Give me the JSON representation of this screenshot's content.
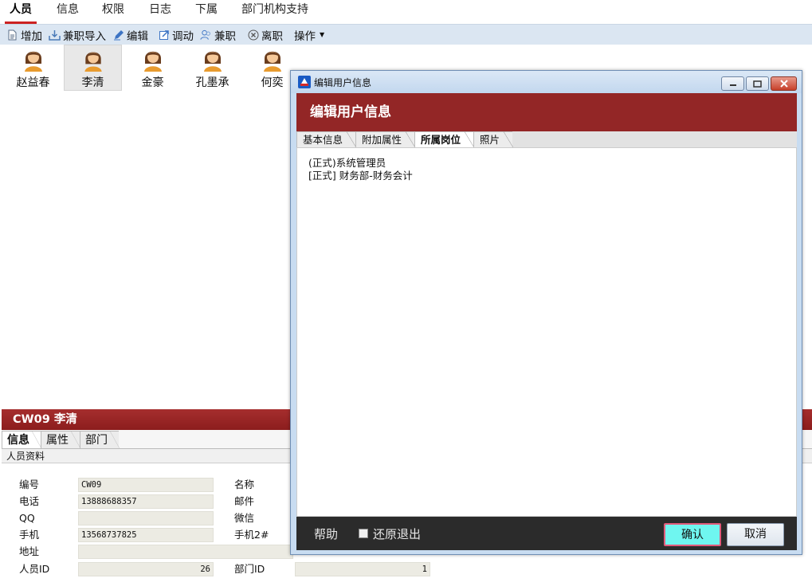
{
  "top_menu": [
    "人员",
    "信息",
    "权限",
    "日志",
    "下属",
    "部门机构支持"
  ],
  "toolbar": {
    "add": "增加",
    "import": "兼职导入",
    "edit": "编辑",
    "transfer": "调动",
    "parttime": "兼职",
    "resign": "离职",
    "actions": "操作"
  },
  "users": [
    "赵益春",
    "李清",
    "金豪",
    "孔墨承",
    "何奕"
  ],
  "detail": {
    "header": "CW09 李清",
    "tabs": [
      "信息",
      "属性",
      "部门"
    ],
    "section": "人员资料",
    "fields": {
      "code_label": "编号",
      "code": "CW09",
      "name_label": "名称",
      "phone_label": "电话",
      "phone": "13888688357",
      "email_label": "邮件",
      "qq_label": "QQ",
      "qq": "",
      "wechat_label": "微信",
      "mobile_label": "手机",
      "mobile": "13568737825",
      "mobile2_label": "手机2#",
      "address_label": "地址",
      "address": "",
      "userid_label": "人员ID",
      "userid": "26",
      "deptid_label": "部门ID",
      "deptid": "1"
    }
  },
  "dialog": {
    "window_title": "编辑用户信息",
    "banner": "编辑用户信息",
    "tabs": [
      "基本信息",
      "附加属性",
      "所属岗位",
      "照片"
    ],
    "active_tab": "所属岗位",
    "positions": [
      "(正式)系统管理员",
      "[正式] 财务部-财务会计"
    ],
    "help": "帮助",
    "restore_exit": "还原退出",
    "ok": "确认",
    "cancel": "取消"
  }
}
